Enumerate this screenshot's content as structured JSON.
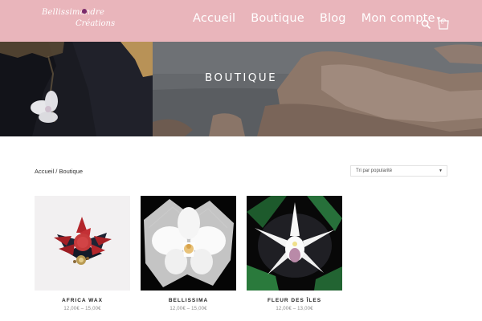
{
  "header": {
    "logo_line1": "Bellissimandre",
    "logo_line2": "Créations",
    "nav": [
      {
        "label": "Accueil"
      },
      {
        "label": "Boutique"
      },
      {
        "label": "Blog"
      },
      {
        "label": "Mon compte"
      }
    ],
    "cart_count": "0"
  },
  "hero": {
    "title": "BOUTIQUE"
  },
  "breadcrumb": {
    "home": "Accueil",
    "separator": " / ",
    "current": "Boutique"
  },
  "sort": {
    "selected": "Tri par popularité"
  },
  "products": [
    {
      "name": "AFRICA WAX",
      "price": "12,00€ – 15,00€"
    },
    {
      "name": "BELLISSIMA",
      "price": "12,00€ – 15,00€"
    },
    {
      "name": "FLEUR DES ÎLES",
      "price": "12,00€ – 13,00€"
    }
  ],
  "colors": {
    "header_bg": "#e9b5bb",
    "text": "#333333",
    "price": "#888888"
  },
  "icons": {
    "search": "search-icon",
    "cart": "shopping-bag-icon"
  }
}
